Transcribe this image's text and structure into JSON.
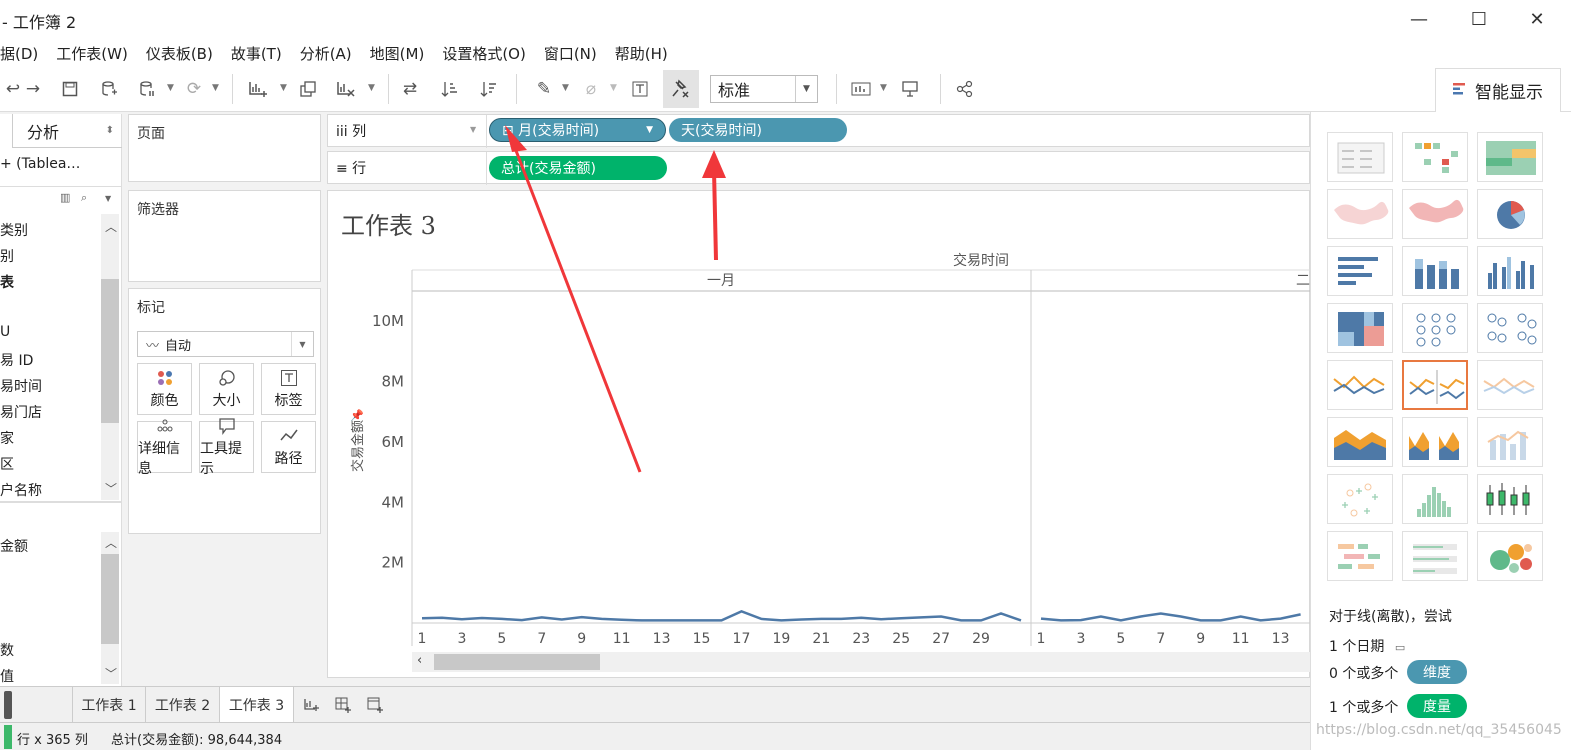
{
  "window": {
    "title": "- 工作簿 2",
    "minimize": "—",
    "maximize": "☐",
    "close": "✕"
  },
  "menu": [
    "据(D)",
    "工作表(W)",
    "仪表板(B)",
    "故事(T)",
    "分析(A)",
    "地图(M)",
    "设置格式(O)",
    "窗口(N)",
    "帮助(H)"
  ],
  "toolbar": {
    "view_select": "标准",
    "smart_display": "智能显示"
  },
  "datapane": {
    "analysis_tab": "分析",
    "source": "+ (Tablea…",
    "dimensions": [
      "类别",
      "别",
      "表",
      "",
      "U",
      "易 ID",
      "易时间",
      "易门店",
      "家",
      "区",
      "户名称"
    ],
    "measures": [
      "金额",
      "",
      "",
      "",
      "数",
      "值"
    ]
  },
  "cards": {
    "pages": "页面",
    "filters": "筛选器",
    "marks": "标记",
    "mark_type": "自动",
    "mark_buttons": [
      "颜色",
      "大小",
      "标签",
      "详细信息",
      "工具提示",
      "路径"
    ]
  },
  "shelves": {
    "columns_label": "iii 列",
    "rows_label": "≡ 行",
    "column_pills": [
      "⊟ 月(交易时间)",
      "天(交易时间)"
    ],
    "row_pills": [
      "总计(交易金额)"
    ]
  },
  "view": {
    "sheet_title": "工作表 3",
    "header_top": "交易时间",
    "month_1": "一月",
    "month_2": "二",
    "axis_label": "交易金额"
  },
  "chart_data": {
    "type": "line",
    "title": "工作表 3",
    "xlabel": "交易时间",
    "ylabel": "交易金额",
    "y_ticks": [
      "10M",
      "8M",
      "6M",
      "4M",
      "2M"
    ],
    "ylim": [
      0,
      11000000
    ],
    "panes": [
      {
        "name": "一月",
        "x_ticks": [
          "1",
          "3",
          "5",
          "7",
          "9",
          "11",
          "13",
          "15",
          "17",
          "19",
          "21",
          "23",
          "25",
          "27",
          "29"
        ],
        "x": [
          1,
          2,
          3,
          4,
          5,
          6,
          7,
          8,
          9,
          10,
          11,
          12,
          13,
          14,
          15,
          16,
          17,
          18,
          19,
          20,
          21,
          22,
          23,
          24,
          25,
          26,
          27,
          28,
          29,
          30,
          31
        ],
        "values": [
          90000,
          110000,
          60000,
          100000,
          70000,
          30000,
          120000,
          50000,
          130000,
          70000,
          40000,
          20000,
          20000,
          20000,
          20000,
          20000,
          320000,
          70000,
          20000,
          50000,
          70000,
          70000,
          110000,
          60000,
          90000,
          120000,
          150000,
          20000,
          20000,
          250000,
          20000
        ]
      },
      {
        "name": "二",
        "x_ticks": [
          "1",
          "3",
          "5",
          "7",
          "9",
          "11",
          "13"
        ],
        "x": [
          1,
          2,
          3,
          4,
          5,
          6,
          7,
          8,
          9,
          10,
          11,
          12,
          13,
          14
        ],
        "values": [
          80000,
          20000,
          30000,
          150000,
          20000,
          150000,
          250000,
          150000,
          20000,
          20000,
          150000,
          20000,
          80000,
          220000
        ]
      }
    ]
  },
  "showme": {
    "hint": "对于线(离散)，尝试",
    "req1": "1 个日期",
    "req2": "0 个或多个",
    "req2_pill": "维度",
    "req3": "1 个或多个",
    "req3_pill": "度量",
    "dim_color": "#4b97b0",
    "measure_color": "#00b36b"
  },
  "sheettabs": [
    "工作表 1",
    "工作表 2",
    "工作表 3"
  ],
  "status": {
    "rows_cols": "行 x 365 列",
    "sum": "总计(交易金额): 98,644,384"
  },
  "watermark": "https://blog.csdn.net/qq_35456045"
}
